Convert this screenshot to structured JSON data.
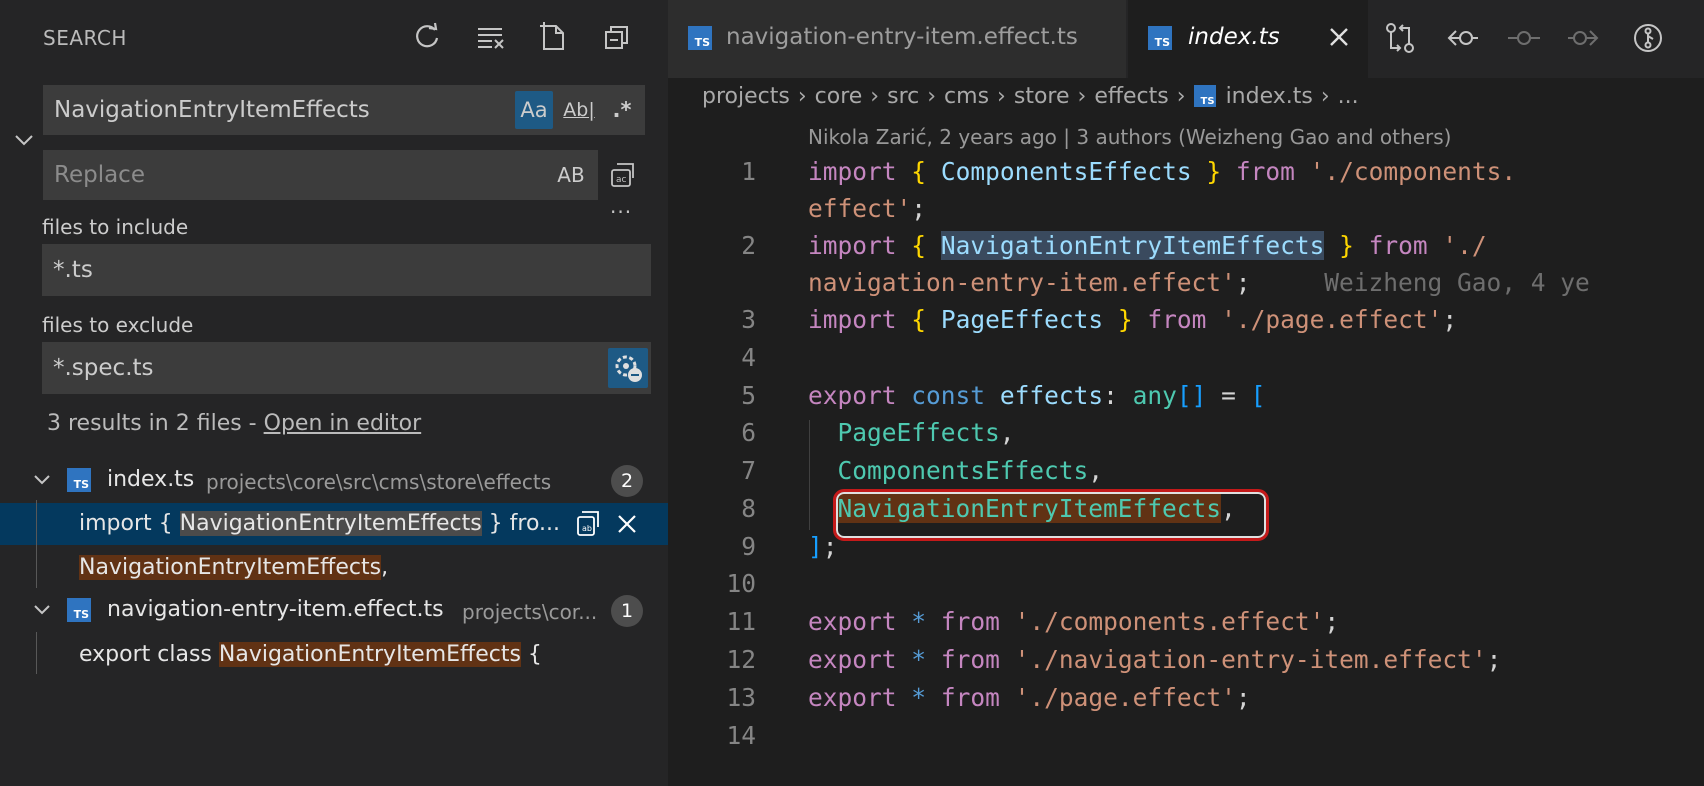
{
  "sidebar": {
    "title": "SEARCH",
    "header_actions": [
      "refresh-icon",
      "clear-results-icon",
      "new-search-editor-icon",
      "collapse-all-icon"
    ],
    "search": {
      "value": "NavigationEntryItemEffects",
      "opt_case": "Aa",
      "opt_word": "Ab|",
      "opt_regex": ".*"
    },
    "replace": {
      "placeholder": "Replace",
      "preserve_case": "AB"
    },
    "more_label": "···",
    "include": {
      "label": "files to include",
      "value": "*.ts"
    },
    "exclude": {
      "label": "files to exclude",
      "value": "*.spec.ts"
    },
    "summary": {
      "text": "3 results in 2 files - ",
      "link": "Open in editor"
    },
    "files": [
      {
        "name": "index.ts",
        "path": "projects\\core\\src\\cms\\store\\effects",
        "count": "2",
        "matches": [
          {
            "before": "import { ",
            "match": "NavigationEntryItemEffects",
            "after": " } fro..."
          },
          {
            "before": "",
            "match": "NavigationEntryItemEffects",
            "after": ","
          }
        ]
      },
      {
        "name": "navigation-entry-item.effect.ts",
        "path": "projects\\cor...",
        "count": "1",
        "matches": [
          {
            "before": "export class ",
            "match": "NavigationEntryItemEffects",
            "after": " {"
          }
        ]
      }
    ]
  },
  "editor": {
    "tabs": [
      {
        "label": "navigation-entry-item.effect.ts",
        "badge": "TS"
      },
      {
        "label": "index.ts",
        "badge": "TS"
      }
    ],
    "breadcrumb": [
      "projects",
      "core",
      "src",
      "cms",
      "store",
      "effects",
      "index.ts",
      "..."
    ],
    "codelens": "Nikola Zarić, 2 years ago | 3 authors (Weizheng Gao and others)",
    "blame": "Weizheng Gao, 4 ye",
    "line_numbers": [
      "1",
      "2",
      "3",
      "4",
      "5",
      "6",
      "7",
      "8",
      "9",
      "10",
      "11",
      "12",
      "13",
      "14"
    ],
    "code": {
      "l1a": [
        "import",
        "{",
        "ComponentsEffects",
        "}",
        "from",
        "'./components."
      ],
      "l1b": "effect'",
      "l2a": [
        "import",
        "{",
        "NavigationEntryItemEffects",
        "}",
        "from",
        "'./"
      ],
      "l2b": "navigation-entry-item.effect'",
      "l3": [
        "import",
        "{",
        "PageEffects",
        "}",
        "from",
        "'./page.effect'"
      ],
      "l5": [
        "export",
        "const",
        "effects",
        "any",
        "[]",
        "[",
        "="
      ],
      "l6": "PageEffects",
      "l7": "ComponentsEffects",
      "l8": "NavigationEntryItemEffects",
      "l9": "]",
      "l11": [
        "export",
        "*",
        "from",
        "'./components.effect'"
      ],
      "l12": [
        "export",
        "*",
        "from",
        "'./navigation-entry-item.effect'"
      ],
      "l13": [
        "export",
        "*",
        "from",
        "'./page.effect'"
      ]
    }
  },
  "colors": {
    "accent": "#04395e",
    "find_match": "#613214",
    "ts_badge": "#2f74c0"
  }
}
